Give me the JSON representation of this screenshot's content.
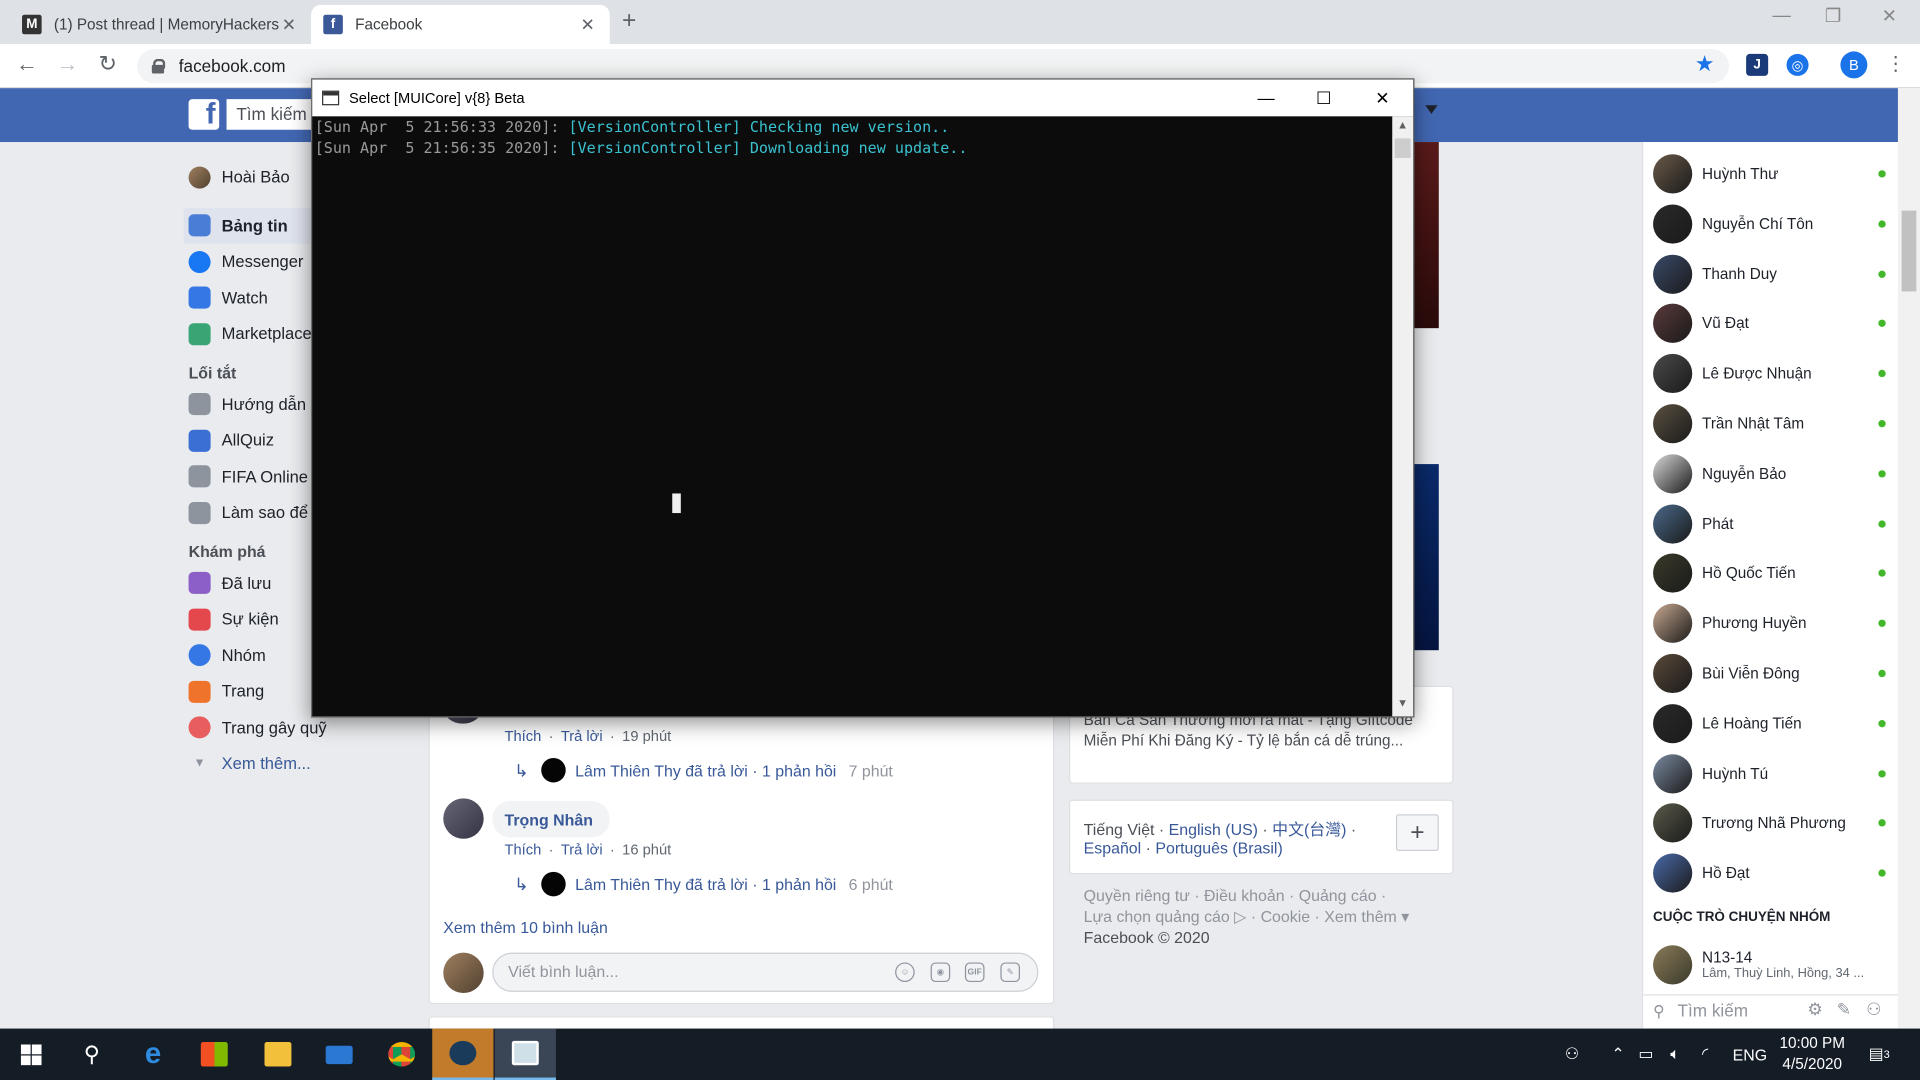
{
  "browser": {
    "tabs": [
      {
        "label": "(1) Post thread | MemoryHackers",
        "active": false
      },
      {
        "label": "Facebook",
        "active": true
      }
    ],
    "new_tab": "+",
    "window_controls": {
      "minimize": "—",
      "maximize": "❐",
      "close": "✕"
    },
    "address": "facebook.com",
    "profile_initial": "B"
  },
  "facebook": {
    "search_placeholder": "Tìm kiếm",
    "user_name": "Hoài Bảo",
    "nav_items": [
      "Bảng tin",
      "Messenger",
      "Watch",
      "Marketplace"
    ],
    "shortcuts_heading": "Lối tắt",
    "shortcuts": [
      "Hướng dẫn ...",
      "AllQuiz",
      "FIFA Online ...",
      "Làm sao để ..."
    ],
    "explore_heading": "Khám phá",
    "explore": [
      "Đã lưu",
      "Sự kiện",
      "Nhóm",
      "Trang",
      "Trang gây quỹ"
    ],
    "see_more": "Xem thêm...",
    "comments": [
      {
        "actions": [
          "Thích",
          "Trả lời",
          "19 phút"
        ],
        "reply": {
          "text": "Lâm Thiên Thy đã trả lời · 1 phản hồi",
          "time": "7 phút"
        }
      },
      {
        "author": "Trọng Nhân",
        "actions": [
          "Thích",
          "Trả lời",
          "16 phút"
        ],
        "reply": {
          "text": "Lâm Thiên Thy đã trả lời · 1 phản hồi",
          "time": "6 phút"
        }
      }
    ],
    "more_comments": "Xem thêm 10 bình luận",
    "comment_placeholder": "Viết bình luận...",
    "comment_tools": [
      "☺",
      "◉",
      "GIF",
      "✎"
    ],
    "ad_text": "Bắn Cá Sân Thưởng mới ra mắt - Tặng Giftcode Miễn Phí Khi Đăng Ký - Tỷ lệ bắn cá dễ trúng...",
    "languages": {
      "current": "Tiếng Việt",
      "others": [
        "English (US)",
        "中文(台灣)",
        "Español",
        "Português (Brasil)"
      ]
    },
    "footer_lines": [
      "Quyền riêng tư · Điều khoản · Quảng cáo ·",
      "Lựa chọn quảng cáo ▷ · Cookie · Xem thêm ▾",
      "Facebook © 2020"
    ],
    "contacts": [
      "Huỳnh Thư",
      "Nguyễn Chí Tôn",
      "Thanh Duy",
      "Vũ Đạt",
      "Lê Được Nhuận",
      "Trần Nhật Tâm",
      "Nguyễn Bảo",
      "Phát",
      "Hồ Quốc Tiến",
      "Phương Huyền",
      "Bùi Viễn Đông",
      "Lê Hoàng Tiến",
      "Huỳnh Tú",
      "Trương Nhã Phương",
      "Hồ Đạt"
    ],
    "group_heading": "CUỘC TRÒ CHUYỆN NHÓM",
    "group": {
      "name": "N13-14",
      "members": "Lâm, Thuỳ Linh, Hồng, 34 ..."
    },
    "chat_search": "Tìm kiếm"
  },
  "console": {
    "title": "Select [MUICore] v{8} Beta",
    "lines": [
      {
        "ts": "[Sun Apr  5 21:56:33 2020]: ",
        "msg": "[VersionController] Checking new version.."
      },
      {
        "ts": "[Sun Apr  5 21:56:35 2020]: ",
        "msg": "[VersionController] Downloading new update.."
      }
    ]
  },
  "taskbar": {
    "lang": "ENG",
    "time": "10:00 PM",
    "date": "4/5/2020",
    "notifications": "3"
  }
}
